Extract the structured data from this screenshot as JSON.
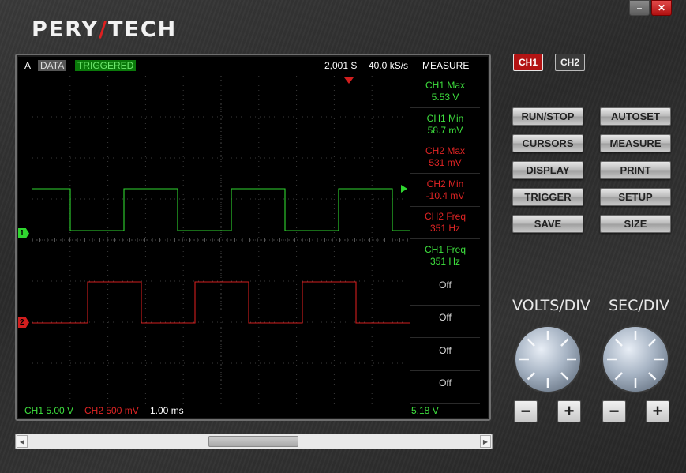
{
  "app": {
    "logo_left": "PERY",
    "logo_mid": "/",
    "logo_right": "TECH"
  },
  "window": {
    "minimize": "–",
    "close": "✕"
  },
  "screen": {
    "mode": "A",
    "tag_data": "DATA",
    "tag_triggered": "TRIGGERED",
    "samples": "2,001 S",
    "rate": "40.0 kS/s",
    "measure_title": "MEASURE",
    "ch1_scale": "CH1 5.00 V",
    "ch2_scale": "CH2 500 mV",
    "time_scale": "1.00 ms",
    "readout": "5.18 V",
    "ch1_marker": "1",
    "ch2_marker": "2"
  },
  "measurements": [
    {
      "label": "CH1 Max",
      "value": "5.53 V",
      "color": "green"
    },
    {
      "label": "CH1 Min",
      "value": "58.7 mV",
      "color": "green"
    },
    {
      "label": "CH2 Max",
      "value": "531 mV",
      "color": "red"
    },
    {
      "label": "CH2 Min",
      "value": "-10.4 mV",
      "color": "red"
    },
    {
      "label": "CH2 Freq",
      "value": "351 Hz",
      "color": "red"
    },
    {
      "label": "CH1 Freq",
      "value": "351 Hz",
      "color": "green"
    },
    {
      "label": "Off",
      "value": "",
      "color": "off"
    },
    {
      "label": "Off",
      "value": "",
      "color": "off"
    },
    {
      "label": "Off",
      "value": "",
      "color": "off"
    },
    {
      "label": "Off",
      "value": "",
      "color": "off"
    }
  ],
  "colors": {
    "ch1": "#2fd62f",
    "ch2": "#d21e1e",
    "grid": "#3a3a3a"
  },
  "panel": {
    "ch1": "CH1",
    "ch2": "CH2",
    "run_stop": "RUN/STOP",
    "autoset": "AUTOSET",
    "cursors": "CURSORS",
    "measure": "MEASURE",
    "display": "DISPLAY",
    "print": "PRINT",
    "trigger": "TRIGGER",
    "setup": "SETUP",
    "save": "SAVE",
    "size": "SIZE",
    "volts_div": "VOLTS/DIV",
    "sec_div": "SEC/DIV",
    "minus": "−",
    "plus": "+"
  },
  "icons": {
    "scroll_left": "◀",
    "scroll_right": "▶"
  }
}
